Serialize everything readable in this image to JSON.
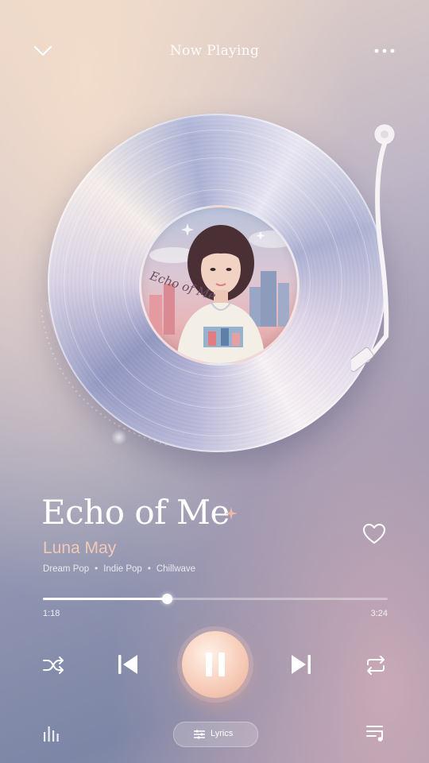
{
  "header": {
    "title": "Now Playing",
    "collapse_icon": "chevron-down-icon",
    "more_icon": "more-horizontal-icon"
  },
  "album": {
    "label_text": "Echo of Me",
    "art": "album-cover-girl-city"
  },
  "track": {
    "title": "Echo of Me",
    "artist": "Luna May",
    "genres": [
      "Dream Pop",
      "Indie Pop",
      "Chillwave"
    ],
    "liked": false,
    "elapsed": "1:18",
    "duration": "3:24",
    "progress_fraction": 0.36
  },
  "controls": {
    "shuffle": "shuffle-icon",
    "previous": "skip-previous-icon",
    "play_state": "playing",
    "next": "skip-next-icon",
    "repeat": "repeat-icon"
  },
  "footer": {
    "lyrics_label": "Lyrics",
    "equalizer_icon": "equalizer-icon",
    "queue_icon": "queue-icon"
  },
  "colors": {
    "accent": "#f2c9b6",
    "play_button": "#f7cdb9"
  }
}
